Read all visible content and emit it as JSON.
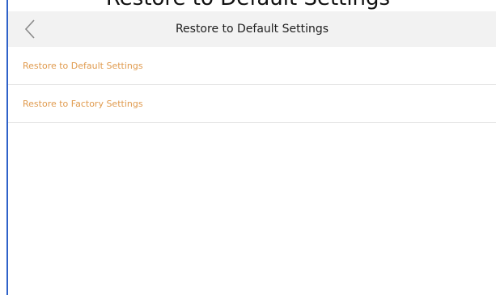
{
  "previous_page": {
    "title_fragment": "Restore to Default Settings"
  },
  "header": {
    "back_icon": "chevron-left-icon",
    "title": "Restore to Default Settings"
  },
  "menu": {
    "items": [
      {
        "label": "Restore to Default Settings"
      },
      {
        "label": "Restore to Factory Settings"
      }
    ]
  },
  "colors": {
    "accent": "#e09b4f",
    "header_background": "#f2f2f2",
    "divider": "#e6e6e6",
    "frame_border": "#2f62c9"
  }
}
